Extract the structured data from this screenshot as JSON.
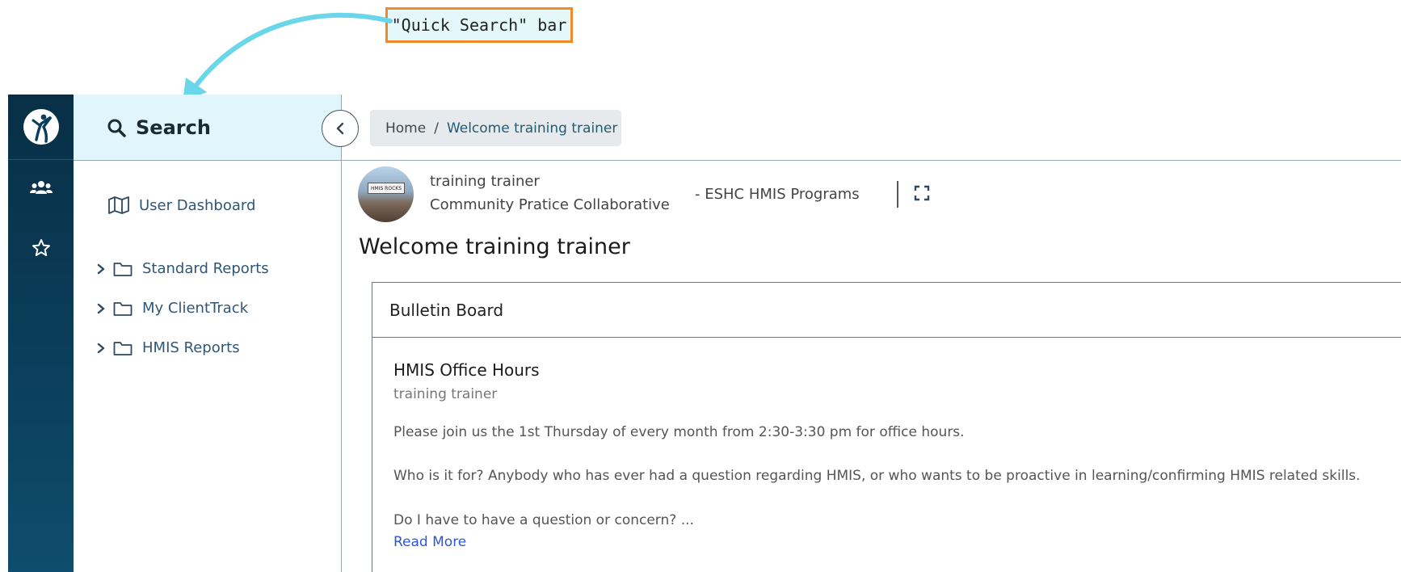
{
  "annotation": {
    "label": "\"Quick Search\" bar"
  },
  "rail": {
    "logo_icon": "dancer-logo-icon",
    "items": [
      {
        "icon": "users-icon"
      },
      {
        "icon": "star-icon"
      }
    ]
  },
  "nav": {
    "search_label": "Search",
    "search_icon": "search-icon",
    "collapse_icon": "chevron-left-icon",
    "items": [
      {
        "label": "User Dashboard",
        "icon": "map-icon"
      },
      {
        "label": "Standard Reports",
        "icon": "folder-icon"
      },
      {
        "label": "My ClientTrack",
        "icon": "folder-icon"
      },
      {
        "label": "HMIS Reports",
        "icon": "folder-icon"
      }
    ]
  },
  "breadcrumb": {
    "home": "Home",
    "separator": "/",
    "current": "Welcome training trainer"
  },
  "user": {
    "name": "training trainer",
    "organization": "Community Pratice Collaborative",
    "program": "- ESHC HMIS Programs",
    "avatar_banner": "HMIS ROCKS"
  },
  "page": {
    "title": "Welcome training trainer"
  },
  "bulletin": {
    "header": "Bulletin Board",
    "post": {
      "title": "HMIS Office Hours",
      "author": "training trainer",
      "paragraphs": [
        "Please join us the 1st Thursday of every month from 2:30-3:30 pm for office hours.",
        "Who is it for?  Anybody who has ever had a question regarding HMIS, or who wants to be proactive in learning/confirming HMIS related skills.",
        "Do I have to have a question or concern? ..."
      ],
      "read_more": "Read More"
    }
  },
  "colors": {
    "accent": "#f0892a",
    "rail": "#0b3e5b",
    "link": "#2b55d8",
    "search_bg": "#e1f6fa"
  }
}
